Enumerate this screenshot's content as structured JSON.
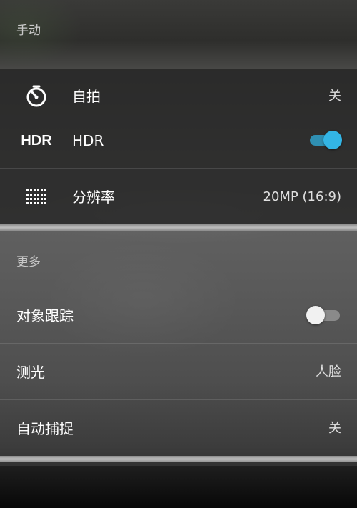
{
  "section_manual": "手动",
  "section_more": "更多",
  "rows": {
    "selftimer": {
      "label": "自拍",
      "value": "关",
      "icon": "timer-icon"
    },
    "hdr": {
      "icon_text": "HDR",
      "label": "HDR",
      "toggle": "on"
    },
    "resolution": {
      "label": "分辨率",
      "value": "20MP (16:9)",
      "icon": "grid-dots-icon"
    },
    "tracking": {
      "label": "对象跟踪",
      "toggle": "off"
    },
    "metering": {
      "label": "测光",
      "value": "人脸"
    },
    "autocapture": {
      "label": "自动捕捉",
      "value": "关"
    }
  },
  "colors": {
    "toggle_on": "#33b5e5",
    "toggle_off_thumb": "#f1f1f1"
  }
}
